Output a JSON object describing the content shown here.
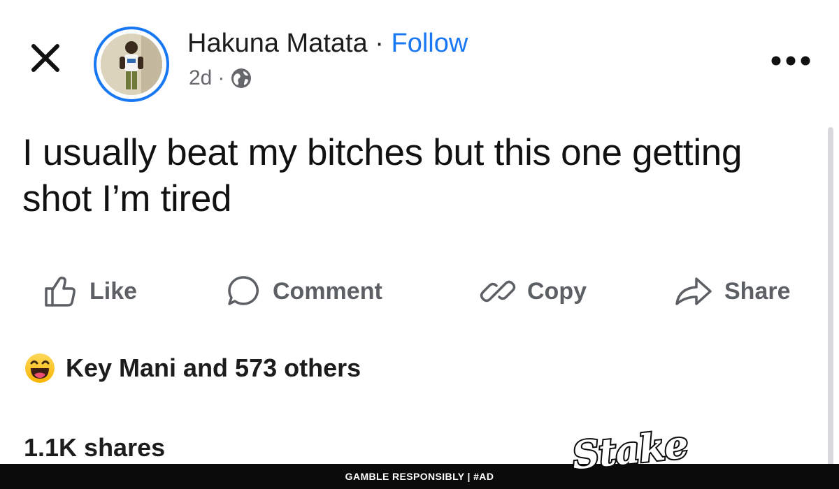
{
  "header": {
    "close_icon": "close-icon",
    "author_name": "Hakuna Matata",
    "separator": "·",
    "follow_label": "Follow",
    "time_ago": "2d",
    "meta_separator": "·",
    "privacy_icon": "globe-icon",
    "more_icon": "more-horizontal-icon"
  },
  "post": {
    "text": "I usually beat my bitches but this one getting shot I’m tired"
  },
  "actions": [
    {
      "label": "Like",
      "icon": "thumbs-up-icon"
    },
    {
      "label": "Comment",
      "icon": "comment-bubble-icon"
    },
    {
      "label": "Copy",
      "icon": "link-icon"
    },
    {
      "label": "Share",
      "icon": "share-arrow-icon"
    }
  ],
  "reactions": {
    "icon": "laughing-emoji-icon",
    "summary": "Key Mani and 573 others"
  },
  "shares": {
    "count_label": "1.1K shares"
  },
  "ad_banner": {
    "text": "GAMBLE RESPONSIBLY  |  #AD",
    "logo_text": "Stake"
  },
  "colors": {
    "accent": "#1877f2",
    "text": "#1c1c1e",
    "muted": "#65676b",
    "action": "#5c5f64",
    "banner": "#0b0b0b"
  }
}
